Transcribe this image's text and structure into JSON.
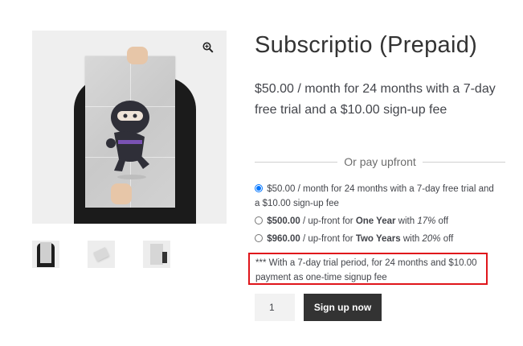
{
  "product": {
    "title": "Subscriptio (Prepaid)",
    "price_summary": "$50.00 / month for 24 months with a 7-day free trial and a $10.00 sign-up fee"
  },
  "divider_label": "Or pay upfront",
  "options": [
    {
      "price": "$50.00",
      "rest": " / month for 24 months with a 7-day free trial and a $10.00 sign-up fee",
      "selected": true
    },
    {
      "price": "$500.00",
      "mid": " / up-front for ",
      "period": "One Year",
      "with": " with ",
      "discount": "17%",
      "tail": " off",
      "selected": false
    },
    {
      "price": "$960.00",
      "mid": " / up-front for ",
      "period": "Two Years",
      "with": " with ",
      "discount": "20%",
      "tail": " off",
      "selected": false
    }
  ],
  "note": "*** With a 7-day trial period, for 24 months and $10.00 payment as one-time signup fee",
  "quantity": "1",
  "signup_label": "Sign up now",
  "icons": {
    "zoom": "magnifier-plus-icon"
  },
  "colors": {
    "highlight_border": "#e0151b",
    "button_bg": "#333333"
  }
}
